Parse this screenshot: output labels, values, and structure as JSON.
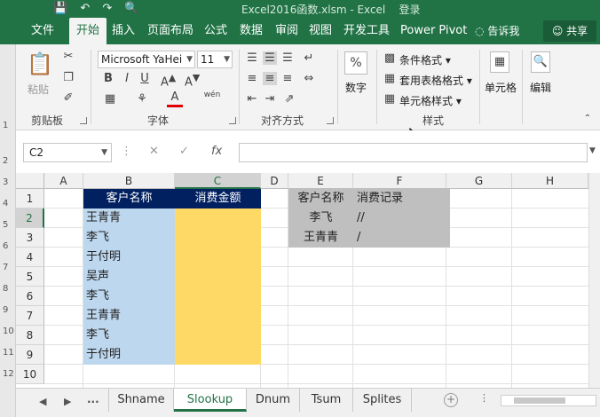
{
  "window": {
    "title": "Excel2016函数.xlsm - Excel",
    "account": "登录"
  },
  "tabs": [
    "文件",
    "开始",
    "插入",
    "页面布局",
    "公式",
    "数据",
    "审阅",
    "视图",
    "开发工具",
    "Power Pivot"
  ],
  "active_tab": "开始",
  "tell_me": "告诉我",
  "share": "共享",
  "ribbon": {
    "clipboard": {
      "label": "剪贴板",
      "paste": "粘贴"
    },
    "font": {
      "label": "字体",
      "name": "Microsoft YaHei",
      "size": "11",
      "bold": "B",
      "italic": "I",
      "underline": "U",
      "font_color_glyph": "A",
      "phonetic": "wén"
    },
    "alignment": {
      "label": "对齐方式"
    },
    "number": {
      "label": "数字",
      "button": "数字",
      "percent": "%"
    },
    "styles": {
      "label": "样式",
      "conditional": "条件格式",
      "table": "套用表格格式",
      "cell_styles": "单元格样式"
    },
    "cells": {
      "button": "单元格"
    },
    "editing": {
      "button": "编辑"
    }
  },
  "formula_bar": {
    "name_box": "C2",
    "formula": "",
    "fx": "fx"
  },
  "grid": {
    "columns": [
      "A",
      "B",
      "C",
      "D",
      "E",
      "F",
      "G",
      "H"
    ],
    "rows": [
      "1",
      "2",
      "3",
      "4",
      "5",
      "6",
      "7",
      "8",
      "9",
      "10"
    ],
    "table1": {
      "headers": [
        "客户名称",
        "消费金额"
      ],
      "names": [
        "王青青",
        "李飞",
        "于付明",
        "吴声",
        "李飞",
        "王青青",
        "李飞",
        "于付明"
      ]
    },
    "table2": {
      "headers": [
        "客户名称",
        "消费记录"
      ],
      "rows": [
        [
          "李飞",
          "//"
        ],
        [
          "王青青",
          "/"
        ]
      ]
    }
  },
  "sheet_tabs": [
    "Shname",
    "Slookup",
    "Dnum",
    "Tsum",
    "Splites"
  ],
  "active_sheet": "Slookup",
  "sheet_nav": "...",
  "colors": {
    "excel_green": "#217346",
    "header_navy": "#002060",
    "names_fill": "#bdd7ee",
    "amount_fill": "#ffd966",
    "lookup_fill": "#bfbfbf"
  }
}
